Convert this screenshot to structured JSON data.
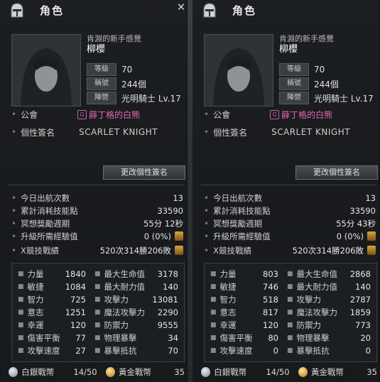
{
  "panels": [
    {
      "window_title": "角色",
      "subtitle": "肯淵的新手感覺",
      "name": "柳櫻",
      "info": [
        {
          "key": "等級",
          "value": "70"
        },
        {
          "key": "稱號",
          "value": "244個"
        },
        {
          "key": "陣營",
          "value": "光明騎士 Lv.17"
        }
      ],
      "guild_label": "公會",
      "guild_icon": "G",
      "guild_name": "薛丁格的白熊",
      "signature_label": "個性簽名",
      "signature_value": "SCARLET KNIGHT",
      "change_sig_button": "更改個性簽名",
      "stats": [
        {
          "key": "今日出航次數",
          "value": "13"
        },
        {
          "key": "累計消耗技能點",
          "value": "33590"
        },
        {
          "key": "冥想獎勵週期",
          "value": "55分 12秒"
        },
        {
          "key": "升級所需經驗值",
          "value": "0 (0%)"
        }
      ],
      "pvp_label": "X競技戰績",
      "pvp_value": "520次314勝206敗",
      "attrs_left": [
        {
          "key": "力量",
          "value": "1840"
        },
        {
          "key": "敏捷",
          "value": "1084"
        },
        {
          "key": "智力",
          "value": "725"
        },
        {
          "key": "意志",
          "value": "1251"
        },
        {
          "key": "幸運",
          "value": "120"
        },
        {
          "key": "傷害平衡",
          "value": "77"
        },
        {
          "key": "攻擊速度",
          "value": "27"
        }
      ],
      "attrs_right": [
        {
          "key": "最大生命值",
          "value": "3178"
        },
        {
          "key": "最大耐力值",
          "value": "140"
        },
        {
          "key": "攻擊力",
          "value": "13081"
        },
        {
          "key": "魔法攻擊力",
          "value": "2290"
        },
        {
          "key": "防禦力",
          "value": "9555"
        },
        {
          "key": "物理暴擊",
          "value": "34"
        },
        {
          "key": "暴擊抵抗",
          "value": "70"
        }
      ],
      "silver_label": "白銀戰幣",
      "silver_value": "14/50",
      "gold_label": "黃金戰幣",
      "gold_value": "35"
    },
    {
      "window_title": "角色",
      "subtitle": "肯淵的新手感覺",
      "name": "柳櫻",
      "info": [
        {
          "key": "等級",
          "value": "70"
        },
        {
          "key": "稱號",
          "value": "244個"
        },
        {
          "key": "陣營",
          "value": "光明騎士 Lv.17"
        }
      ],
      "guild_label": "公會",
      "guild_icon": "G",
      "guild_name": "薛丁格的白熊",
      "signature_label": "個性簽名",
      "signature_value": "SCARLET KNIGHT",
      "change_sig_button": "更改個性簽名",
      "stats": [
        {
          "key": "今日出航次數",
          "value": "13"
        },
        {
          "key": "累計消耗技能點",
          "value": "33590"
        },
        {
          "key": "冥想獎勵週期",
          "value": "55分 43秒"
        },
        {
          "key": "升級所需經驗值",
          "value": "0 (0%)"
        }
      ],
      "pvp_label": "X競技戰績",
      "pvp_value": "520次314勝206敗",
      "attrs_left": [
        {
          "key": "力量",
          "value": "803"
        },
        {
          "key": "敏捷",
          "value": "746"
        },
        {
          "key": "智力",
          "value": "518"
        },
        {
          "key": "意志",
          "value": "817"
        },
        {
          "key": "幸運",
          "value": "120"
        },
        {
          "key": "傷害平衡",
          "value": "80"
        },
        {
          "key": "攻擊速度",
          "value": "0"
        }
      ],
      "attrs_right": [
        {
          "key": "最大生命值",
          "value": "2868"
        },
        {
          "key": "最大耐力值",
          "value": "140"
        },
        {
          "key": "攻擊力",
          "value": "2787"
        },
        {
          "key": "魔法攻擊力",
          "value": "1859"
        },
        {
          "key": "防禦力",
          "value": "773"
        },
        {
          "key": "物理暴擊",
          "value": "20"
        },
        {
          "key": "暴擊抵抗",
          "value": "0"
        }
      ],
      "silver_label": "白銀戰幣",
      "silver_value": "14/50",
      "gold_label": "黃金戰幣",
      "gold_value": "35"
    }
  ],
  "icons": {
    "window": "helmet-icon",
    "close": "close-icon",
    "medal": "medal-icon",
    "silver": "silver-coin-icon",
    "gold": "gold-coin-icon"
  },
  "colors": {
    "guild_name": "#e86ab2",
    "pvp_value": "#f0a43a"
  }
}
